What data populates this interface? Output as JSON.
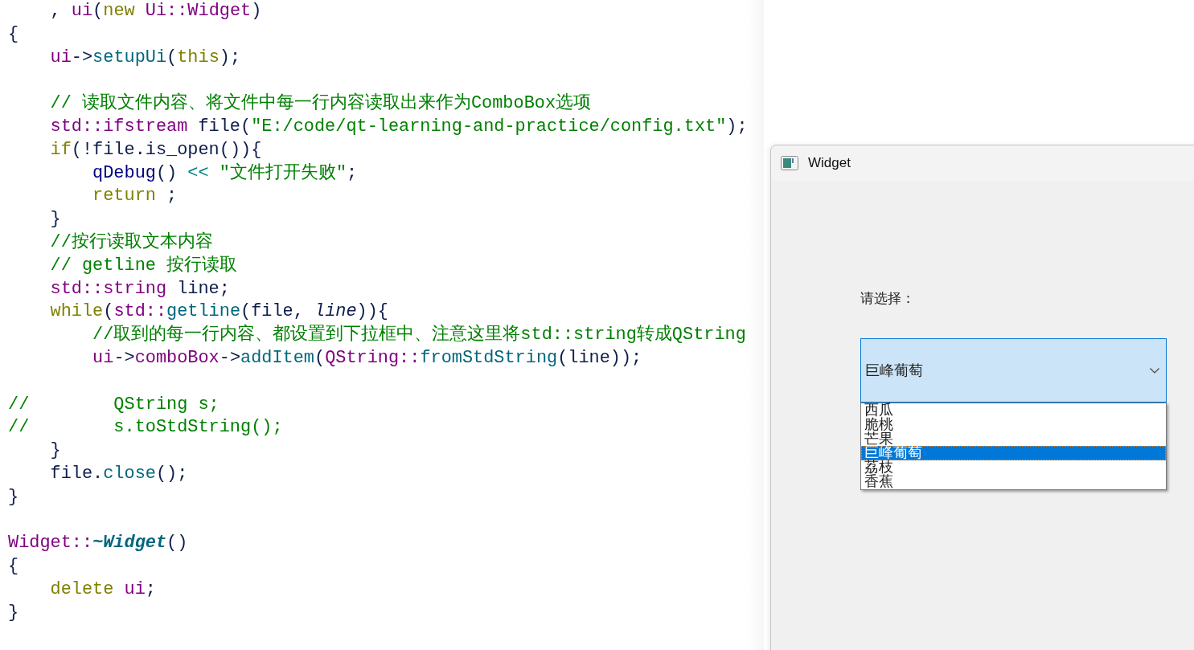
{
  "editor": {
    "lines": [
      {
        "tokens": [
          {
            "text": "    , ",
            "kind": "plain"
          },
          {
            "text": "ui",
            "kind": "type"
          },
          {
            "text": "(",
            "kind": "plain"
          },
          {
            "text": "new",
            "kind": "keyword"
          },
          {
            "text": " Ui::Widget",
            "kind": "type"
          },
          {
            "text": ")",
            "kind": "plain"
          }
        ]
      },
      {
        "tokens": [
          {
            "text": "{",
            "kind": "plain"
          }
        ]
      },
      {
        "tokens": [
          {
            "text": "    ui",
            "kind": "type"
          },
          {
            "text": "->",
            "kind": "plain"
          },
          {
            "text": "setupUi",
            "kind": "function"
          },
          {
            "text": "(",
            "kind": "plain"
          },
          {
            "text": "this",
            "kind": "keyword"
          },
          {
            "text": ");",
            "kind": "plain"
          }
        ]
      },
      {
        "blank_before": true,
        "tokens": [
          {
            "text": "    // 读取文件内容、将文件中每一行内容读取出来作为ComboBox选项",
            "kind": "comment"
          }
        ]
      },
      {
        "tokens": [
          {
            "text": "    std::ifstream",
            "kind": "type"
          },
          {
            "text": " file(",
            "kind": "plain"
          },
          {
            "text": "\"E:/code/qt-learning-and-practice/config.txt\"",
            "kind": "string"
          },
          {
            "text": ");",
            "kind": "plain"
          }
        ]
      },
      {
        "tokens": [
          {
            "text": "    if",
            "kind": "keyword"
          },
          {
            "text": "(!file.is_open()){",
            "kind": "plain"
          }
        ]
      },
      {
        "tokens": [
          {
            "text": "        qDebug",
            "kind": "macro"
          },
          {
            "text": "() ",
            "kind": "plain"
          },
          {
            "text": "<<",
            "kind": "operator"
          },
          {
            "text": " \"文件打开失败\"",
            "kind": "string"
          },
          {
            "text": ";",
            "kind": "plain"
          }
        ]
      },
      {
        "tokens": [
          {
            "text": "        return",
            "kind": "keyword"
          },
          {
            "text": " ;",
            "kind": "plain"
          }
        ]
      },
      {
        "tokens": [
          {
            "text": "    }",
            "kind": "plain"
          }
        ]
      },
      {
        "tokens": [
          {
            "text": "    //按行读取文本内容",
            "kind": "comment"
          }
        ]
      },
      {
        "tokens": [
          {
            "text": "    // getline 按行读取",
            "kind": "comment"
          }
        ]
      },
      {
        "tokens": [
          {
            "text": "    std::string",
            "kind": "type"
          },
          {
            "text": " line;",
            "kind": "plain"
          }
        ]
      },
      {
        "tokens": [
          {
            "text": "    while",
            "kind": "keyword"
          },
          {
            "text": "(",
            "kind": "plain"
          },
          {
            "text": "std::",
            "kind": "type"
          },
          {
            "text": "getline",
            "kind": "function"
          },
          {
            "text": "(file, ",
            "kind": "plain"
          },
          {
            "text": "line",
            "kind": "italic"
          },
          {
            "text": ")){",
            "kind": "plain"
          }
        ]
      },
      {
        "tokens": [
          {
            "text": "        //取到的每一行内容、都设置到下拉框中、注意这里将std::string转成QString",
            "kind": "comment"
          }
        ]
      },
      {
        "tokens": [
          {
            "text": "        ui",
            "kind": "type"
          },
          {
            "text": "->",
            "kind": "plain"
          },
          {
            "text": "comboBox",
            "kind": "type"
          },
          {
            "text": "->",
            "kind": "plain"
          },
          {
            "text": "addItem",
            "kind": "function"
          },
          {
            "text": "(",
            "kind": "plain"
          },
          {
            "text": "QString::",
            "kind": "type"
          },
          {
            "text": "fromStdString",
            "kind": "function"
          },
          {
            "text": "(line));",
            "kind": "plain"
          }
        ]
      },
      {
        "blank_before": true,
        "tokens": [
          {
            "text": "//        QString s;",
            "kind": "comment"
          }
        ]
      },
      {
        "tokens": [
          {
            "text": "//        s.toStdString();",
            "kind": "comment"
          }
        ]
      },
      {
        "tokens": [
          {
            "text": "    }",
            "kind": "plain"
          }
        ]
      },
      {
        "tokens": [
          {
            "text": "    file.",
            "kind": "plain"
          },
          {
            "text": "close",
            "kind": "function"
          },
          {
            "text": "();",
            "kind": "plain"
          }
        ]
      },
      {
        "tokens": [
          {
            "text": "}",
            "kind": "plain"
          }
        ]
      },
      {
        "blank_before": true,
        "tokens": [
          {
            "text": "Widget::",
            "kind": "type"
          },
          {
            "text": "~Widget",
            "kind": "declaration"
          },
          {
            "text": "()",
            "kind": "plain"
          }
        ]
      },
      {
        "tokens": [
          {
            "text": "{",
            "kind": "plain"
          }
        ]
      },
      {
        "tokens": [
          {
            "text": "    delete",
            "kind": "keyword"
          },
          {
            "text": " ui",
            "kind": "type"
          },
          {
            "text": ";",
            "kind": "plain"
          }
        ]
      },
      {
        "tokens": [
          {
            "text": "}",
            "kind": "plain"
          }
        ]
      }
    ]
  },
  "window": {
    "title": "Widget",
    "label": "请选择：",
    "combo_box": {
      "value": "巨峰葡萄",
      "expanded": true
    },
    "dropdown": [
      {
        "label": "西瓜",
        "selected": false
      },
      {
        "label": "脆桃",
        "selected": false
      },
      {
        "label": "芒果",
        "selected": false
      },
      {
        "label": "巨峰葡萄",
        "selected": true
      },
      {
        "label": "荔枝",
        "selected": false
      },
      {
        "label": "香蕉",
        "selected": false
      }
    ]
  }
}
